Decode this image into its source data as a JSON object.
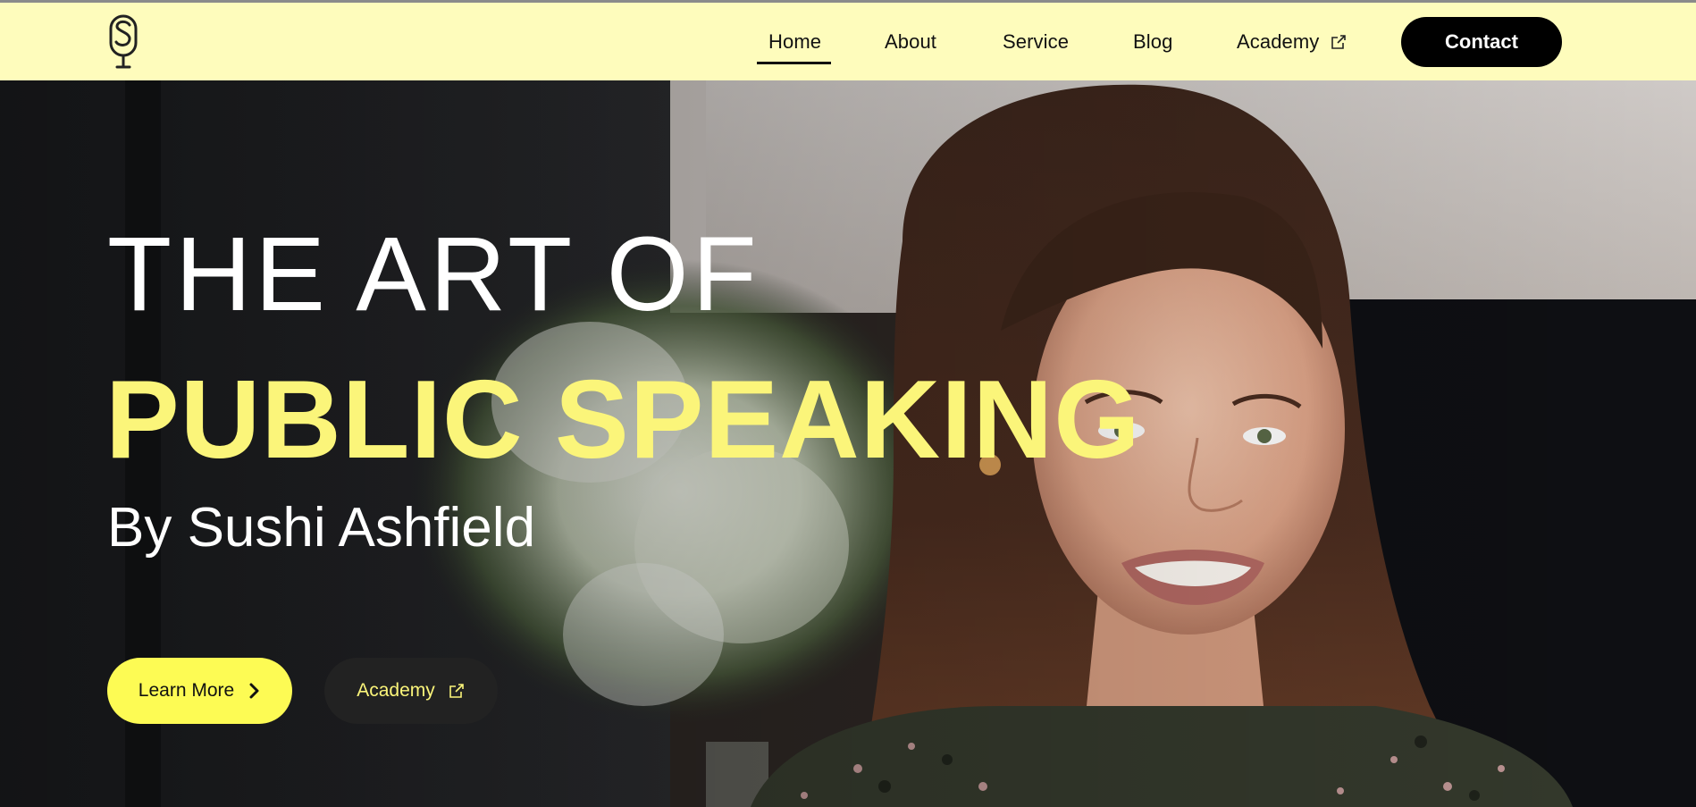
{
  "nav": {
    "items": [
      {
        "label": "Home"
      },
      {
        "label": "About"
      },
      {
        "label": "Service"
      },
      {
        "label": "Blog"
      },
      {
        "label": "Academy"
      }
    ],
    "active": "Home",
    "contact_label": "Contact"
  },
  "hero": {
    "title_line1": "THE ART OF",
    "title_line2": "PUBLIC SPEAKING",
    "byline": "By Sushi Ashfield",
    "learn_more_label": "Learn More",
    "academy_label": "Academy"
  },
  "colors": {
    "navbar_bg": "#fefcbc",
    "accent_yellow": "#fdfb54",
    "title_yellow": "#fbf57a",
    "dark": "#000000"
  },
  "icons": {
    "logo": "microphone-s-logo-icon",
    "external": "external-link-icon",
    "chevron": "chevron-right-icon"
  }
}
